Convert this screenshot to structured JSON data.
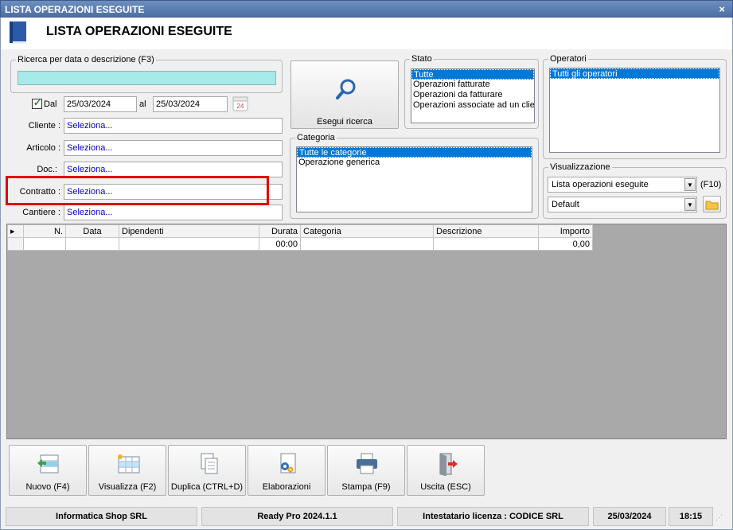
{
  "window": {
    "title": "LISTA OPERAZIONI ESEGUITE",
    "close": "×"
  },
  "header": {
    "title": "LISTA OPERAZIONI ESEGUITE"
  },
  "search": {
    "legend": "Ricerca per data o descrizione (F3)",
    "value": ""
  },
  "dates": {
    "from_label": "Dal",
    "from_value": "25/03/2024",
    "to_label": "al",
    "to_value": "25/03/2024",
    "calendar_day": "24"
  },
  "filters": {
    "cliente_label": "Cliente :",
    "cliente_value": "Seleziona...",
    "articolo_label": "Articolo :",
    "articolo_value": "Seleziona...",
    "doc_label": "Doc.:",
    "doc_value": "Seleziona...",
    "contratto_label": "Contratto :",
    "contratto_value": "Seleziona...",
    "cantiere_label": "Cantiere :",
    "cantiere_value": "Seleziona..."
  },
  "search_button": {
    "label": "Esegui ricerca"
  },
  "stato": {
    "legend": "Stato",
    "items": [
      "Tutte",
      "Operazioni fatturate",
      "Operazioni da fatturare",
      "Operazioni associate ad un clier"
    ],
    "selected": 0
  },
  "categoria": {
    "legend": "Categoria",
    "items": [
      "Tutte le categorie",
      "Operazione generica"
    ],
    "selected": 0
  },
  "operatori": {
    "legend": "Operatori",
    "items": [
      "Tutti gli operatori"
    ],
    "selected": 0
  },
  "visualizzazione": {
    "legend": "Visualizzazione",
    "view_value": "Lista operazioni eseguite",
    "shortcut": "(F10)",
    "layout_value": "Default"
  },
  "grid": {
    "columns": [
      "N.",
      "Data",
      "Dipendenti",
      "Durata",
      "Categoria",
      "Descrizione",
      "Importo"
    ],
    "rows": [
      [
        "",
        "",
        "",
        "00:00",
        "",
        "",
        "0,00"
      ]
    ]
  },
  "toolbar": {
    "nuovo": "Nuovo (F4)",
    "visualizza": "Visualizza (F2)",
    "duplica": "Duplica (CTRL+D)",
    "elaborazioni": "Elaborazioni",
    "stampa": "Stampa (F9)",
    "uscita": "Uscita (ESC)"
  },
  "statusbar": {
    "company": "Informatica Shop SRL",
    "version": "Ready Pro 2024.1.1",
    "license": "Intestatario licenza : CODICE SRL",
    "date": "25/03/2024",
    "time": "18:15"
  },
  "colors": {
    "titlebar": "#4d6ea3",
    "selection": "#0078d7",
    "highlight": "#e00000",
    "search_field": "#a6eaea"
  }
}
